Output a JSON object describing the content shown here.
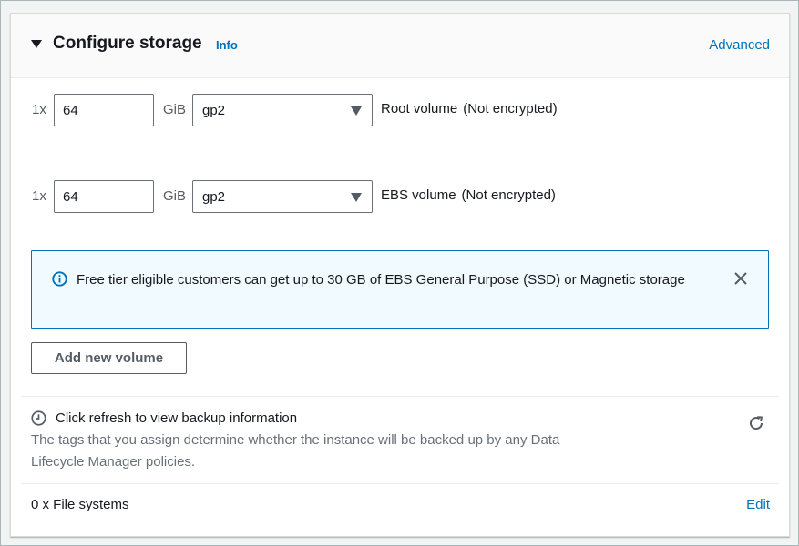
{
  "section": {
    "title": "Configure storage",
    "info_label": "Info",
    "advanced_label": "Advanced"
  },
  "volumes": [
    {
      "quantity": "1x",
      "size": "64",
      "unit": "GiB",
      "type": "gp2",
      "label": "Root volume",
      "encryption": "(Not encrypted)"
    },
    {
      "quantity": "1x",
      "size": "64",
      "unit": "GiB",
      "type": "gp2",
      "label": "EBS volume",
      "encryption": "(Not encrypted)"
    }
  ],
  "alert": {
    "icon": "info-circle-icon",
    "text": "Free tier eligible customers can get up to 30 GB of EBS General Purpose (SSD) or Magnetic storage",
    "dismiss_icon": "close-icon"
  },
  "add_volume_label": "Add new volume",
  "backup": {
    "icon": "clock-icon",
    "title": "Click refresh to view backup information",
    "description": "The tags that you assign determine whether the instance will be backed up by any Data Lifecycle Manager policies.",
    "refresh_icon": "refresh-icon"
  },
  "file_systems": {
    "count_label": "0 x File systems",
    "edit_label": "Edit"
  },
  "colors": {
    "link": "#0073bb",
    "alert_bg": "#f1faff",
    "alert_border": "#0073bb",
    "muted_text": "#687078"
  }
}
